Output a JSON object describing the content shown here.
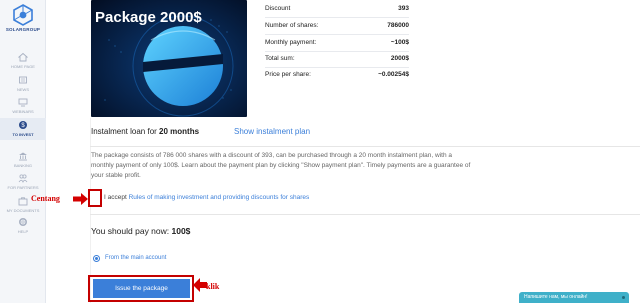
{
  "sidebar": {
    "logo_text": "SOLARGROUP",
    "items": [
      {
        "label": "HOME PAGE",
        "icon": "home-icon"
      },
      {
        "label": "NEWS",
        "icon": "news-icon"
      },
      {
        "label": "WEBINARS",
        "icon": "webinar-icon"
      },
      {
        "label": "TO INVEST",
        "icon": "invest-icon"
      },
      {
        "label": "BANKING",
        "icon": "bank-icon"
      },
      {
        "label": "FOR PARTNERS",
        "icon": "partners-icon"
      },
      {
        "label": "MY DOCUMENTS",
        "icon": "documents-icon"
      },
      {
        "label": "HELP",
        "icon": "help-icon"
      }
    ]
  },
  "package": {
    "banner_title": "Package 2000$"
  },
  "stats": [
    {
      "label": "Discount",
      "value": "393"
    },
    {
      "label": "Number of shares:",
      "value": "786000"
    },
    {
      "label": "Monthly payment:",
      "value": "~100$"
    },
    {
      "label": "Total sum:",
      "value": "2000$"
    },
    {
      "label": "Price per share:",
      "value": "~0.00254$"
    }
  ],
  "instalment": {
    "prefix": "Instalment loan for ",
    "months": "20 months",
    "link": "Show instalment plan"
  },
  "description": "The package consists of 786 000 shares with a discount of 393, can be purchased through a 20 month instalment plan, with a monthly payment of only 100$. Learn about the payment plan by clicking \"Show payment plan\". Timely payments are a guarantee of your stable profit.",
  "agreement": {
    "prefix": "I accept ",
    "link": "Rules of making investment and providing discounts for shares",
    "annotation": "Centang"
  },
  "payment": {
    "prefix": "You should pay now: ",
    "amount": "100$"
  },
  "account_option": "From the main account",
  "issue_button": "Issue the package",
  "issue_annotation": "klik",
  "chat_widget": "Напишите нам, мы онлайн!",
  "colors": {
    "accent": "#3b7fd9",
    "annotation_red": "#c40000",
    "chat": "#3fb0c9"
  }
}
